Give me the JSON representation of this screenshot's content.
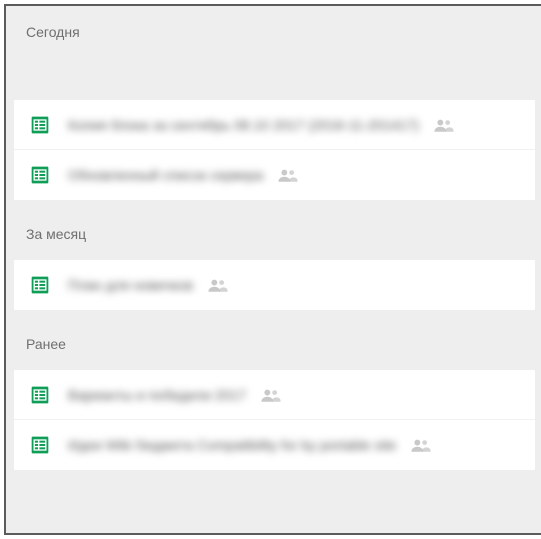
{
  "sections": {
    "today": {
      "label": "Сегодня",
      "items": [
        {
          "title": "Копия блока за сентябрь 08.10 2017 (2016-11-201417)",
          "shared": true
        },
        {
          "title": "Обновленный список сервера",
          "shared": true
        }
      ]
    },
    "month": {
      "label": "За месяц",
      "items": [
        {
          "title": "План для новичков",
          "shared": true
        }
      ]
    },
    "earlier": {
      "label": "Ранее",
      "items": [
        {
          "title": "Варианты и победили 2017",
          "shared": true
        },
        {
          "title": "Идеи Wiki бюджета Compatibility for by portable site",
          "shared": true
        }
      ]
    }
  },
  "icons": {
    "sheets": "sheets-icon",
    "shared": "shared-icon"
  },
  "colors": {
    "accent": "#0f9d58",
    "bg": "#eeeeee",
    "text_muted": "#6f6f6f"
  }
}
